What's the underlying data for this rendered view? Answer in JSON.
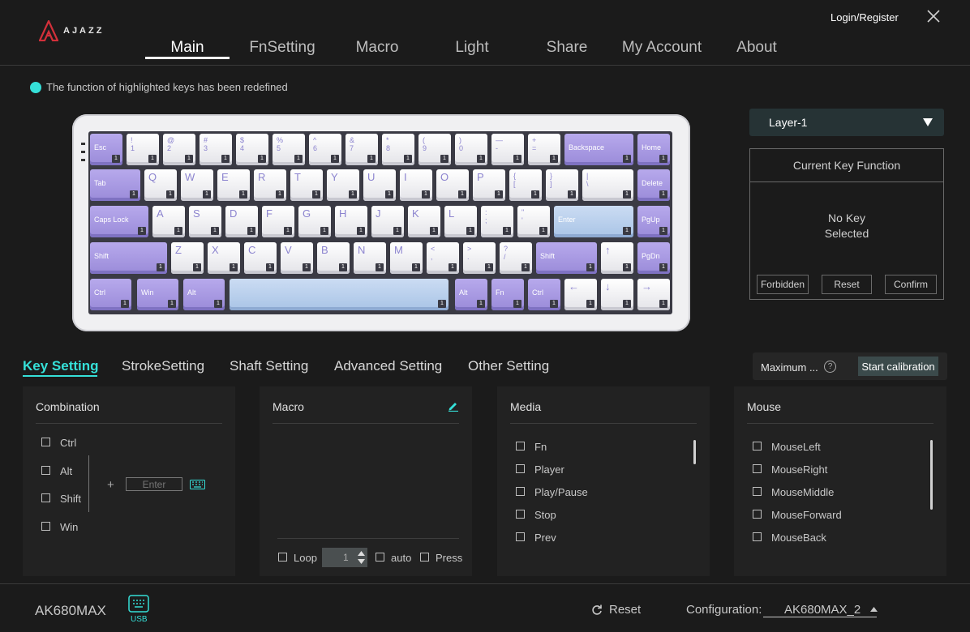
{
  "brand": {
    "logo_text": "AJAZZ"
  },
  "header": {
    "login_label": "Login/Register",
    "tabs": [
      {
        "label": "Main"
      },
      {
        "label": "FnSetting"
      },
      {
        "label": "Macro"
      },
      {
        "label": "Light"
      },
      {
        "label": "Share"
      },
      {
        "label": "My Account"
      },
      {
        "label": "About"
      }
    ],
    "active_tab": "Main"
  },
  "hint": {
    "text": "The function of highlighted keys has been redefined",
    "color": "#35e0d8"
  },
  "keyboard": {
    "layer_badge": "1",
    "rows": [
      [
        "Esc",
        "! 1",
        "@ 2",
        "# 3",
        "$ 4",
        "% 5",
        "^ 6",
        "& 7",
        "* 8",
        "( 9",
        ") 0",
        "— -",
        "+ =",
        "Backspace",
        "Home"
      ],
      [
        "Tab",
        "Q",
        "W",
        "E",
        "R",
        "T",
        "Y",
        "U",
        "I",
        "O",
        "P",
        "{ [",
        "} ]",
        "| \\",
        "Delete"
      ],
      [
        "Caps Lock",
        "A",
        "S",
        "D",
        "F",
        "G",
        "H",
        "J",
        "K",
        "L",
        ": ;",
        "\" '",
        "Enter",
        "PgUp"
      ],
      [
        "Shift",
        "Z",
        "X",
        "C",
        "V",
        "B",
        "N",
        "M",
        "< ,",
        "> .",
        "? /",
        "Shift",
        "↑",
        "PgDn"
      ],
      [
        "Ctrl",
        "Win",
        "Alt",
        "",
        "Alt",
        "Fn",
        "Ctrl",
        "←",
        "↓",
        "→"
      ]
    ]
  },
  "layer_select": {
    "value": "Layer-1"
  },
  "current_key_function": {
    "title": "Current Key Function",
    "line1": "No Key",
    "line2": "Selected",
    "buttons": {
      "forbidden": "Forbidden",
      "reset": "Reset",
      "confirm": "Confirm"
    }
  },
  "sub_tabs": [
    {
      "label": "Key Setting"
    },
    {
      "label": "StrokeSetting"
    },
    {
      "label": "Shaft Setting"
    },
    {
      "label": "Advanced Setting"
    },
    {
      "label": "Other Setting"
    }
  ],
  "calibration": {
    "max_label": "Maximum ...",
    "help": "?",
    "button": "Start calibration"
  },
  "combination": {
    "title": "Combination",
    "modifiers": [
      "Ctrl",
      "Alt",
      "Shift",
      "Win"
    ],
    "plus": "+",
    "key_placeholder": "Enter"
  },
  "macro": {
    "title": "Macro",
    "loop_label": "Loop",
    "loop_value": "1",
    "auto_label": "auto",
    "press_label": "Press"
  },
  "media": {
    "title": "Media",
    "items": [
      "Fn",
      "Player",
      "Play/Pause",
      "Stop",
      "Prev"
    ]
  },
  "mouse": {
    "title": "Mouse",
    "items": [
      "MouseLeft",
      "MouseRight",
      "MouseMiddle",
      "MouseForward",
      "MouseBack"
    ]
  },
  "footer": {
    "model": "AK680MAX",
    "connection": "USB",
    "reset_label": "Reset",
    "config_label": "Configuration:",
    "config_value": "AK680MAX_2"
  },
  "colors": {
    "accent": "#35e0d8",
    "background": "#1b1b1b",
    "key_purple": "#a596e3",
    "key_blue": "#b9d0ee"
  }
}
